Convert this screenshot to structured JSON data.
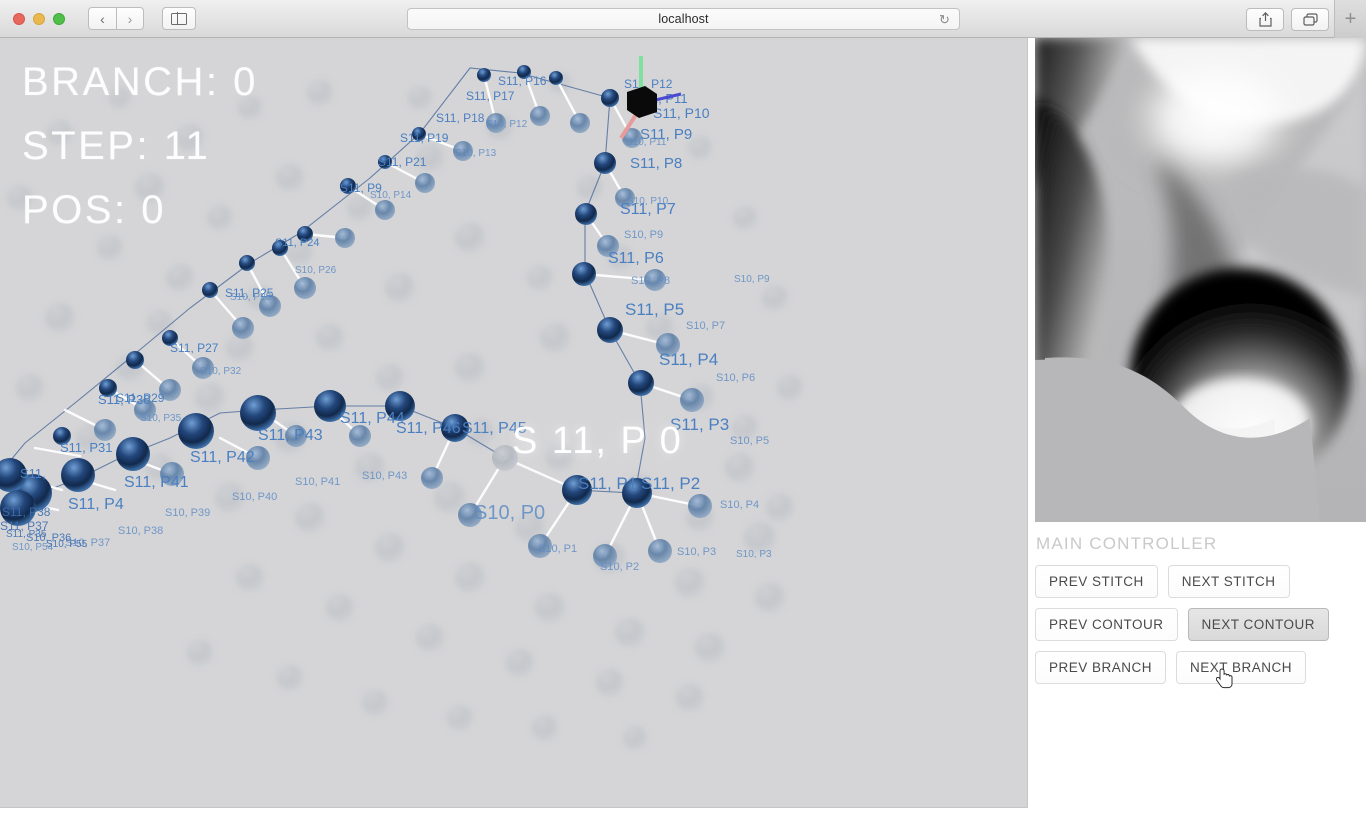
{
  "browser": {
    "title": "localhost",
    "url_text": "localhost",
    "reload_glyph": "↻",
    "back_glyph": "‹",
    "forward_glyph": "›",
    "share_glyph": "⇧",
    "tabs_glyph": "⧉",
    "new_tab_glyph": "+",
    "traffic_lights": [
      "close",
      "minimize",
      "zoom"
    ]
  },
  "hud": {
    "branch_label": "BRANCH: 0",
    "step_label": "STEP: 11",
    "pos_label": "POS: 0",
    "branch_value": 0,
    "step_value": 11,
    "pos_value": 0
  },
  "canvas": {
    "background_color": "#d5d5d7",
    "active_label": "S 11, P 0",
    "node_color_active": "#1b3f72",
    "node_color_mid": "#5b86bd",
    "label_color": "#4a7fc1",
    "link_color": "#ffffff",
    "contour_line_color": "#4f6d99",
    "labels_active_contour": [
      "S11, P12",
      "S11, P11",
      "S11, P10",
      "S11, P9",
      "S11, P8",
      "S11, P7",
      "S11, P6",
      "S11, P5",
      "S11, P4",
      "S11, P3",
      "S11, P2",
      "S11, P1",
      "S11, P0",
      "S11, P16",
      "S11, P17",
      "S11, P18",
      "S11, P19",
      "S11, P21",
      "S11, P25",
      "S11, P26",
      "S11, P27",
      "S11, P28",
      "S11, P29",
      "S11, P30",
      "S11, P31",
      "S11, P41",
      "S11, P42",
      "S11, P43",
      "S11, P44",
      "S11, P45",
      "S11, P46"
    ],
    "labels_neighbor_contour": [
      "S10, P0",
      "S10, P1",
      "S10, P2",
      "S10, P3",
      "S10, P4",
      "S10, P5",
      "S10, P7",
      "S10, P8",
      "S10, P9",
      "S10, P10",
      "S10, P12",
      "S10, P37",
      "S10, P38",
      "S10, P39",
      "S10, P40",
      "S10, P41",
      "S10, P43",
      "S10, P54"
    ],
    "gizmo": {
      "name": "axis-gizmo",
      "axis_x_color": "#e79b9b",
      "axis_y_color": "#7fe0a0",
      "axis_z_color": "#4a4ad0",
      "cube_color": "#000000"
    }
  },
  "preview": {
    "name": "surface-preview",
    "background_color": "#b7b7b9",
    "description": "grayscale shaded surface render"
  },
  "controller": {
    "title": "MAIN CONTROLLER",
    "rows": [
      [
        {
          "label": "PREV STITCH",
          "name": "prev-stitch-button",
          "hovered": false
        },
        {
          "label": "NEXT STITCH",
          "name": "next-stitch-button",
          "hovered": false
        }
      ],
      [
        {
          "label": "PREV CONTOUR",
          "name": "prev-contour-button",
          "hovered": false
        },
        {
          "label": "NEXT CONTOUR",
          "name": "next-contour-button",
          "hovered": true
        }
      ],
      [
        {
          "label": "PREV BRANCH",
          "name": "prev-branch-button",
          "hovered": false
        },
        {
          "label": "NEXT BRANCH",
          "name": "next-branch-button",
          "hovered": false
        }
      ]
    ]
  }
}
